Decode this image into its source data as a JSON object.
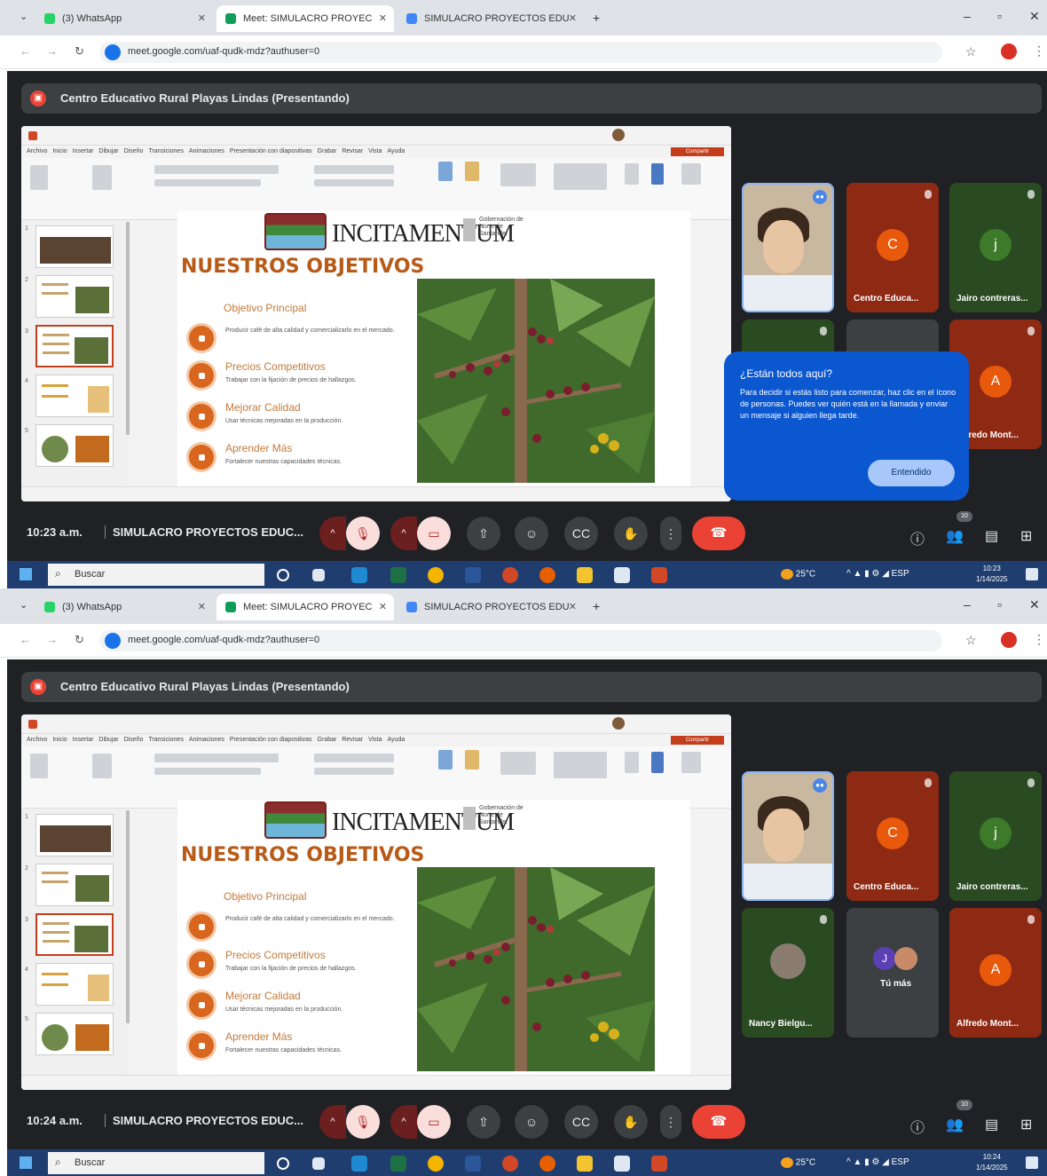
{
  "screens": [
    {
      "browser": {
        "tabs": [
          {
            "label": "(3) WhatsApp",
            "active": false
          },
          {
            "label": "Meet: SIMULACRO PROYEC",
            "active": true
          },
          {
            "label": "SIMULACRO PROYECTOS EDU",
            "active": false
          }
        ],
        "url": "meet.google.com/uaf-qudk-mdz?authuser=0"
      },
      "banner": "Centro Educativo Rural Playas Lindas (Presentando)",
      "slide": {
        "brand": "INCITAMENTUM",
        "gov_text": "Gobernación de Norte de Santander",
        "title": "NUESTROS OBJETIVOS",
        "objective_heading": "Objetivo Principal",
        "objectives": [
          {
            "title": "",
            "desc": "Producir café de alta calidad y comercializarlo en el mercado."
          },
          {
            "title": "Precios Competitivos",
            "desc": "Trabajar con la fijación de precios de hallazgos."
          },
          {
            "title": "Mejorar Calidad",
            "desc": "Usar técnicas mejoradas en la producción."
          },
          {
            "title": "Aprender Más",
            "desc": "Fortalecer nuestras capacidades técnicas."
          }
        ]
      },
      "participants": [
        {
          "name": "",
          "initial": "",
          "kind": "self"
        },
        {
          "name": "Centro Educa...",
          "initial": "C",
          "kind": "red"
        },
        {
          "name": "Jairo contreras...",
          "initial": "j",
          "kind": "green"
        },
        {
          "name": "",
          "initial": "",
          "kind": "green-partial"
        },
        {
          "name": "",
          "initial": "",
          "kind": "grey-partial"
        },
        {
          "name": "Alfredo Mont...",
          "initial": "A",
          "kind": "red"
        }
      ],
      "popup": {
        "title": "¿Están todos aquí?",
        "body": "Para decidir si estás listo para comenzar, haz clic en el ícono de personas. Puedes ver quién está en la llamada y enviar un mensaje si alguien llega tarde.",
        "button": "Entendido"
      },
      "controls": {
        "time": "10:23 a.m.",
        "meeting_title": "SIMULACRO PROYECTOS EDUC...",
        "people_count": "10"
      },
      "taskbar": {
        "search": "Buscar",
        "weather": "25°C",
        "time": "10:23",
        "date": "1/14/2025"
      }
    },
    {
      "browser": {
        "tabs": [
          {
            "label": "(3) WhatsApp",
            "active": false
          },
          {
            "label": "Meet: SIMULACRO PROYEC",
            "active": true
          },
          {
            "label": "SIMULACRO PROYECTOS EDU",
            "active": false
          }
        ],
        "url": "meet.google.com/uaf-qudk-mdz?authuser=0"
      },
      "banner": "Centro Educativo Rural Playas Lindas (Presentando)",
      "slide": {
        "brand": "INCITAMENTUM",
        "gov_text": "Gobernación de Norte de Santander",
        "title": "NUESTROS OBJETIVOS",
        "objective_heading": "Objetivo Principal",
        "objectives": [
          {
            "title": "",
            "desc": "Producir café de alta calidad y comercializarlo en el mercado."
          },
          {
            "title": "Precios Competitivos",
            "desc": "Trabajar con la fijación de precios de hallazgos."
          },
          {
            "title": "Mejorar Calidad",
            "desc": "Usar técnicas mejoradas en la producción."
          },
          {
            "title": "Aprender Más",
            "desc": "Fortalecer nuestras capacidades técnicas."
          }
        ]
      },
      "participants": [
        {
          "name": "",
          "initial": "",
          "kind": "self"
        },
        {
          "name": "Centro Educa...",
          "initial": "C",
          "kind": "red"
        },
        {
          "name": "Jairo contreras...",
          "initial": "j",
          "kind": "green"
        },
        {
          "name": "Nancy Bielgu...",
          "initial": "",
          "kind": "green-photo"
        },
        {
          "name": "Tú más",
          "initial": "J",
          "kind": "grey"
        },
        {
          "name": "Alfredo Mont...",
          "initial": "A",
          "kind": "red"
        }
      ],
      "controls": {
        "time": "10:24 a.m.",
        "meeting_title": "SIMULACRO PROYECTOS EDUC...",
        "people_count": "10"
      },
      "taskbar": {
        "search": "Buscar",
        "weather": "25°C",
        "time": "10:24",
        "date": "1/14/2025"
      }
    }
  ],
  "colors": {
    "meet_bg": "#202124",
    "accent_orange": "#d9661e",
    "popup_blue": "#0b57d0",
    "end_call": "#ea4335"
  },
  "icons": [
    "whatsapp-icon",
    "meet-icon",
    "slides-icon",
    "close-icon",
    "star-icon",
    "mic-off-icon",
    "camera-off-icon",
    "present-icon",
    "emoji-icon",
    "captions-icon",
    "hand-icon",
    "more-icon",
    "end-call-icon",
    "info-icon",
    "people-icon",
    "chat-icon",
    "activities-icon",
    "windows-icon",
    "search-icon"
  ]
}
